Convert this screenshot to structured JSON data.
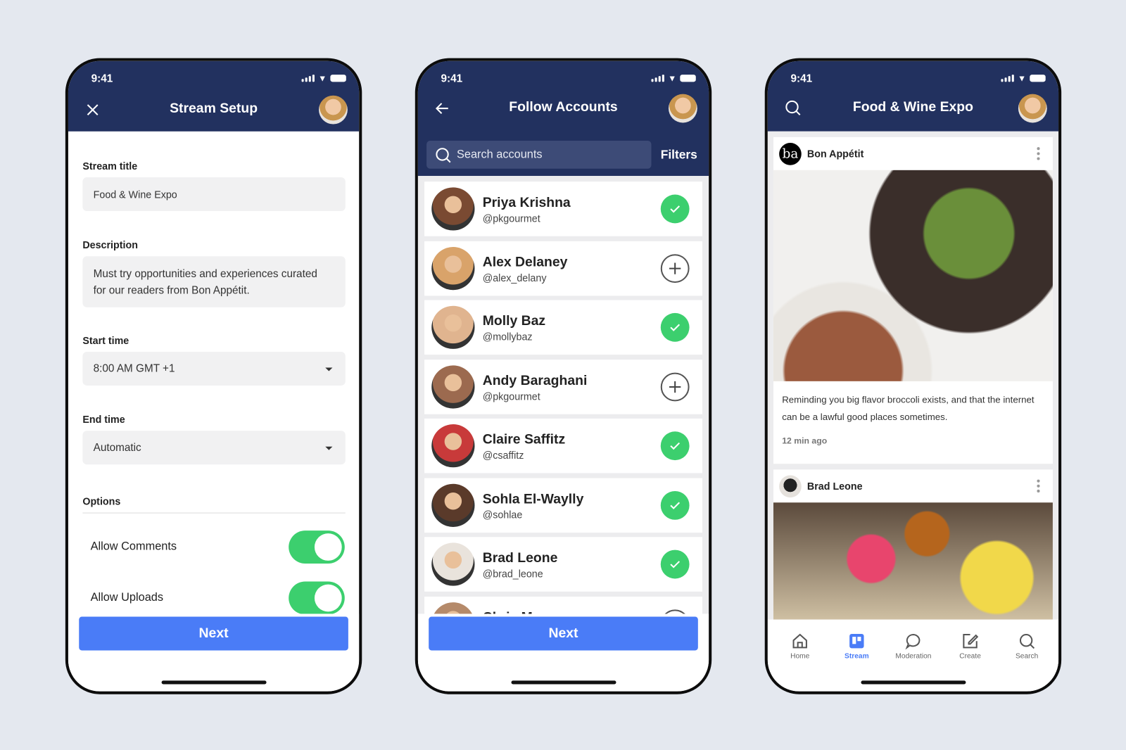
{
  "status_time": "9:41",
  "colors": {
    "header": "#22315f",
    "accent": "#4a7cf7",
    "toggle_on": "#3ccf6e"
  },
  "setup": {
    "title": "Stream Setup",
    "close_icon": "close-icon",
    "stream_title_label": "Stream title",
    "stream_title_value": "Food & Wine Expo",
    "description_label": "Description",
    "description_value": "Must try opportunities and experiences curated for our readers from Bon Appétit.",
    "start_label": "Start time",
    "start_value": "8:00 AM GMT +1",
    "end_label": "End time",
    "end_value": "Automatic",
    "options_label": "Options",
    "options": [
      {
        "label": "Allow Comments",
        "on": true
      },
      {
        "label": "Allow Uploads",
        "on": true
      }
    ],
    "next_label": "Next"
  },
  "follow": {
    "title": "Follow Accounts",
    "search_placeholder": "Search accounts",
    "filters_label": "Filters",
    "accounts": [
      {
        "name": "Priya Krishna",
        "handle": "@pkgourmet",
        "followed": true
      },
      {
        "name": "Alex Delaney",
        "handle": "@alex_delany",
        "followed": false
      },
      {
        "name": "Molly Baz",
        "handle": "@mollybaz",
        "followed": true
      },
      {
        "name": "Andy Baraghani",
        "handle": "@pkgourmet",
        "followed": false
      },
      {
        "name": "Claire Saffitz",
        "handle": "@csaffitz",
        "followed": true
      },
      {
        "name": "Sohla El-Waylly",
        "handle": "@sohlae",
        "followed": true
      },
      {
        "name": "Brad Leone",
        "handle": "@brad_leone",
        "followed": true
      },
      {
        "name": "Chris Morocco",
        "handle": "",
        "followed": false
      }
    ],
    "next_label": "Next"
  },
  "feed": {
    "title": "Food & Wine Expo",
    "posts": [
      {
        "author": "Bon Appétit",
        "logo": "ba",
        "text": "Reminding you big flavor broccoli exists, and that the internet can be a lawful good places sometimes.",
        "time": "12 min ago"
      },
      {
        "author": "Brad Leone"
      }
    ],
    "tabs": [
      {
        "label": "Home",
        "icon": "home-icon"
      },
      {
        "label": "Stream",
        "icon": "stream-icon",
        "active": true
      },
      {
        "label": "Moderation",
        "icon": "chat-bubble-icon"
      },
      {
        "label": "Create",
        "icon": "edit-icon"
      },
      {
        "label": "Search",
        "icon": "search-icon"
      }
    ]
  }
}
